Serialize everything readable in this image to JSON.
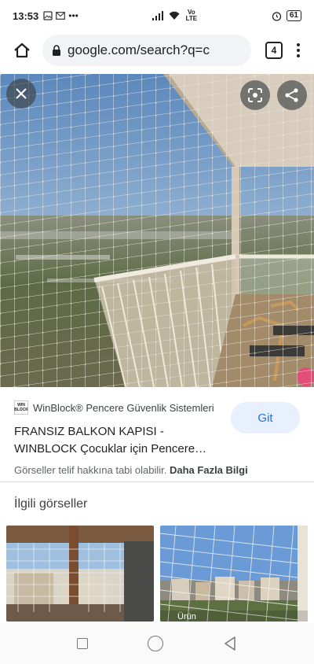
{
  "status": {
    "time": "13:53",
    "volte": "Vo LTE",
    "battery": "61"
  },
  "browser": {
    "url": "google.com/search?q=c",
    "tab_count": "4"
  },
  "viewer": {
    "close_icon": "close-icon",
    "lens_icon": "lens-icon",
    "share_icon": "share-icon"
  },
  "result": {
    "logo_text": "WIN BLOCK",
    "source": "WinBlock® Pencere Güvenlik Sistemleri",
    "go_label": "Git",
    "title": "FRANSIZ BALKON KAPISI - WINBLOCK Çocuklar için Pencere…",
    "copyright": "Görseller telif hakkına tabi olabilir.",
    "more_info": "Daha Fazla Bilgi"
  },
  "related": {
    "title": "İlgili görseller",
    "thumb2_label": "Ürün"
  }
}
